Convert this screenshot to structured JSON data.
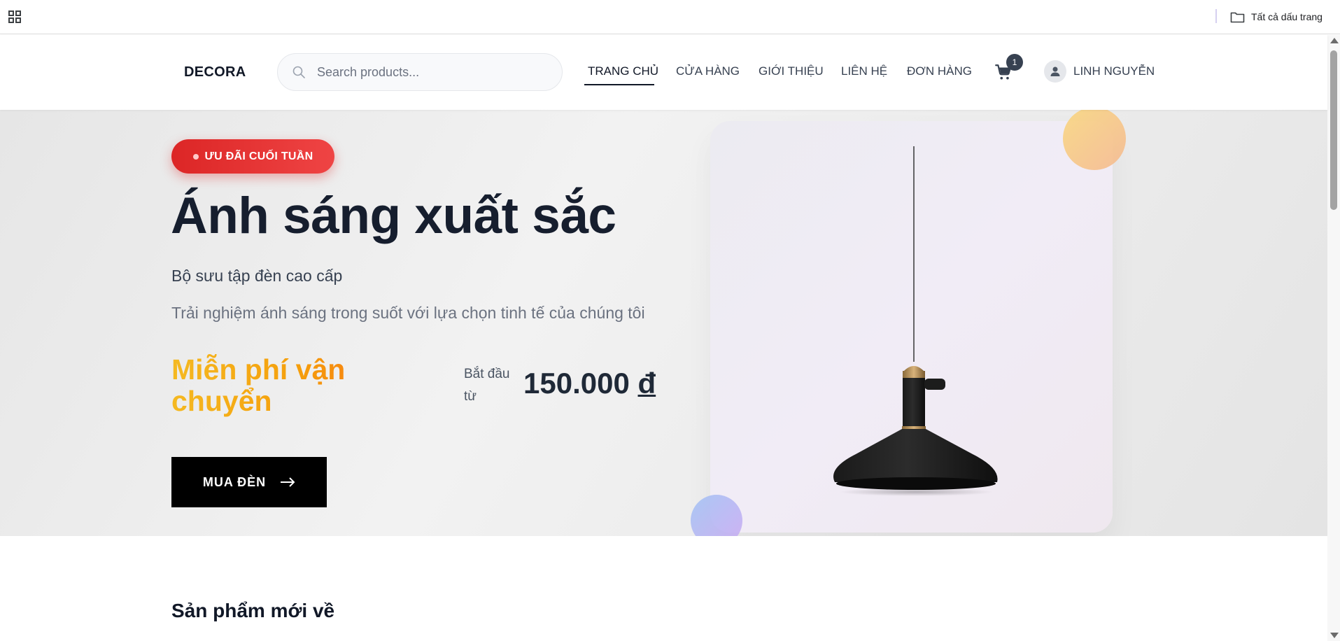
{
  "browser": {
    "bookmarks_all_label": "Tất cả dấu trang",
    "apps_icon": "apps-grid-icon",
    "folder_icon": "folder-icon"
  },
  "header": {
    "logo": "DECORA",
    "search_placeholder": "Search products...",
    "nav": [
      {
        "label": "TRANG CHỦ",
        "active": true
      },
      {
        "label": "CỬA HÀNG",
        "active": false
      },
      {
        "label": "GIỚI THIỆU",
        "active": false
      },
      {
        "label": "LIÊN HỆ",
        "active": false
      },
      {
        "label": "ĐƠN HÀNG",
        "active": false
      }
    ],
    "cart_count": "1",
    "user_name": "LINH NGUYỄN"
  },
  "hero": {
    "badge": "ƯU ĐÃI CUỐI TUẦN",
    "title": "Ánh sáng xuất sắc",
    "subtitle": "Bộ sưu tập đèn cao cấp",
    "description": "Trải nghiệm ánh sáng trong suốt với lựa chọn tinh tế của chúng tôi",
    "free_shipping": "Miễn phí vận chuyển",
    "price_from_label": "Bắt đầu từ",
    "price": "150.000",
    "currency": "đ",
    "cta_label": "MUA ĐÈN"
  },
  "sections": {
    "new_arrivals_title": "Sản phẩm mới về"
  },
  "colors": {
    "badge": "#dc2626",
    "cta": "#000000",
    "free_shipping_gradient": [
      "#f5b921",
      "#f97316"
    ],
    "text_dark": "#161e2e"
  }
}
